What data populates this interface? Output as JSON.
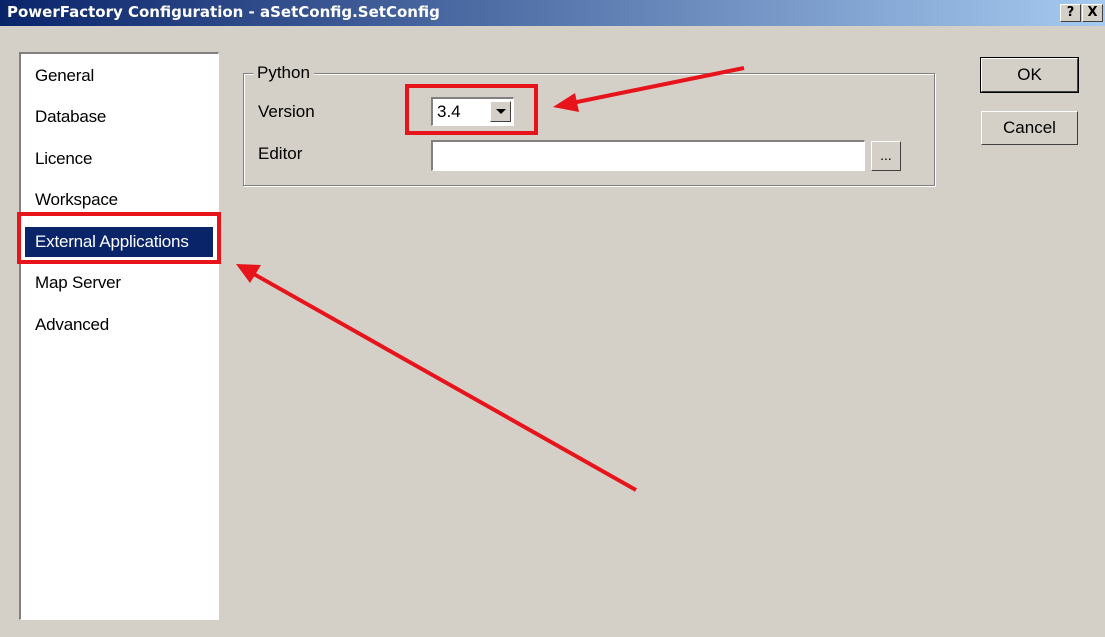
{
  "window": {
    "title": "PowerFactory Configuration - aSetConfig.SetConfig",
    "help_label": "?",
    "close_label": "X"
  },
  "nav": {
    "items": [
      {
        "label": "General"
      },
      {
        "label": "Database"
      },
      {
        "label": "Licence"
      },
      {
        "label": "Workspace"
      },
      {
        "label": "External Applications",
        "selected": true
      },
      {
        "label": "Map Server"
      },
      {
        "label": "Advanced"
      }
    ]
  },
  "python": {
    "group_label": "Python",
    "version_label": "Version",
    "version_value": "3.4",
    "editor_label": "Editor",
    "editor_value": "",
    "browse_label": "..."
  },
  "buttons": {
    "ok": "OK",
    "cancel": "Cancel"
  },
  "annotations": {
    "highlight_color": "#e8141b"
  }
}
